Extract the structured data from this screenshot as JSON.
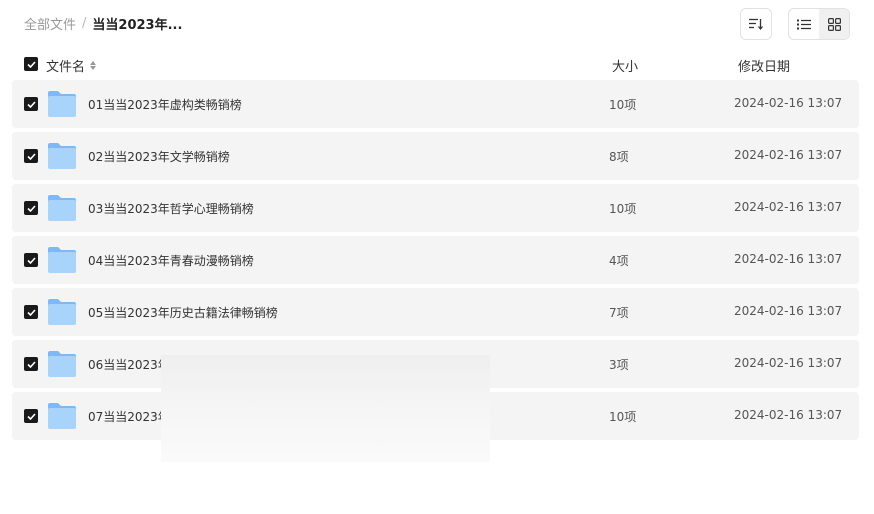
{
  "breadcrumb": {
    "root": "全部文件",
    "separator": "/",
    "current": "当当2023年..."
  },
  "toolbar": {
    "sort_icon": "sort-lines-icon",
    "list_view_icon": "list-view-icon",
    "grid_view_icon": "grid-view-icon"
  },
  "header": {
    "name": "文件名",
    "size": "大小",
    "date": "修改日期"
  },
  "files": [
    {
      "name": "01当当2023年虚构类畅销榜",
      "size": "10项",
      "date": "2024-02-16 13:07"
    },
    {
      "name": "02当当2023年文学畅销榜",
      "size": "8项",
      "date": "2024-02-16 13:07"
    },
    {
      "name": "03当当2023年哲学心理畅销榜",
      "size": "10项",
      "date": "2024-02-16 13:07"
    },
    {
      "name": "04当当2023年青春动漫畅销榜",
      "size": "4项",
      "date": "2024-02-16 13:07"
    },
    {
      "name": "05当当2023年历史古籍法律畅销榜",
      "size": "7项",
      "date": "2024-02-16 13:07"
    },
    {
      "name": "06当当2023年",
      "size": "3项",
      "date": "2024-02-16 13:07"
    },
    {
      "name": "07当当2023年",
      "size": "10项",
      "date": "2024-02-16 13:07"
    }
  ],
  "colors": {
    "row_bg": "#f4f4f5",
    "checkbox": "#1a1a1a",
    "folder_light": "#a8d3fb",
    "folder_dark": "#7dbaf5"
  }
}
